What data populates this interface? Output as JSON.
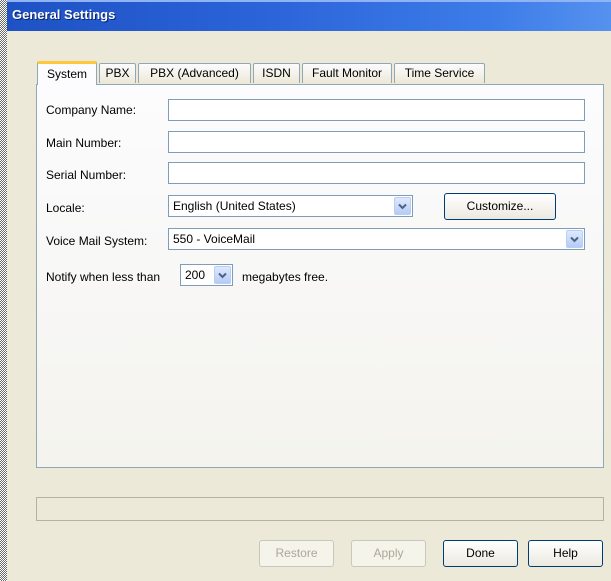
{
  "window": {
    "title": "General Settings"
  },
  "tabs": [
    {
      "label": "System",
      "active": true
    },
    {
      "label": "PBX",
      "active": false
    },
    {
      "label": "PBX (Advanced)",
      "active": false
    },
    {
      "label": "ISDN",
      "active": false
    },
    {
      "label": "Fault Monitor",
      "active": false
    },
    {
      "label": "Time Service",
      "active": false
    }
  ],
  "form": {
    "company_name": {
      "label": "Company Name:",
      "value": ""
    },
    "main_number": {
      "label": "Main Number:",
      "value": ""
    },
    "serial_number": {
      "label": "Serial Number:",
      "value": ""
    },
    "locale": {
      "label": "Locale:",
      "value": "English (United States)",
      "customize_label": "Customize..."
    },
    "voice_mail": {
      "label": "Voice Mail System:",
      "value": "550 - VoiceMail"
    },
    "notify": {
      "prefix": "Notify when less than",
      "value": "200",
      "suffix": "megabytes free."
    }
  },
  "status": {
    "text": ""
  },
  "buttons": {
    "restore": "Restore",
    "apply": "Apply",
    "done": "Done",
    "help": "Help"
  },
  "colors": {
    "title_bar": "#2a62d8",
    "active_tab_accent": "#ffc83c",
    "field_border": "#7f9db9"
  },
  "icons": {
    "dropdown": "chevron-down-icon"
  }
}
